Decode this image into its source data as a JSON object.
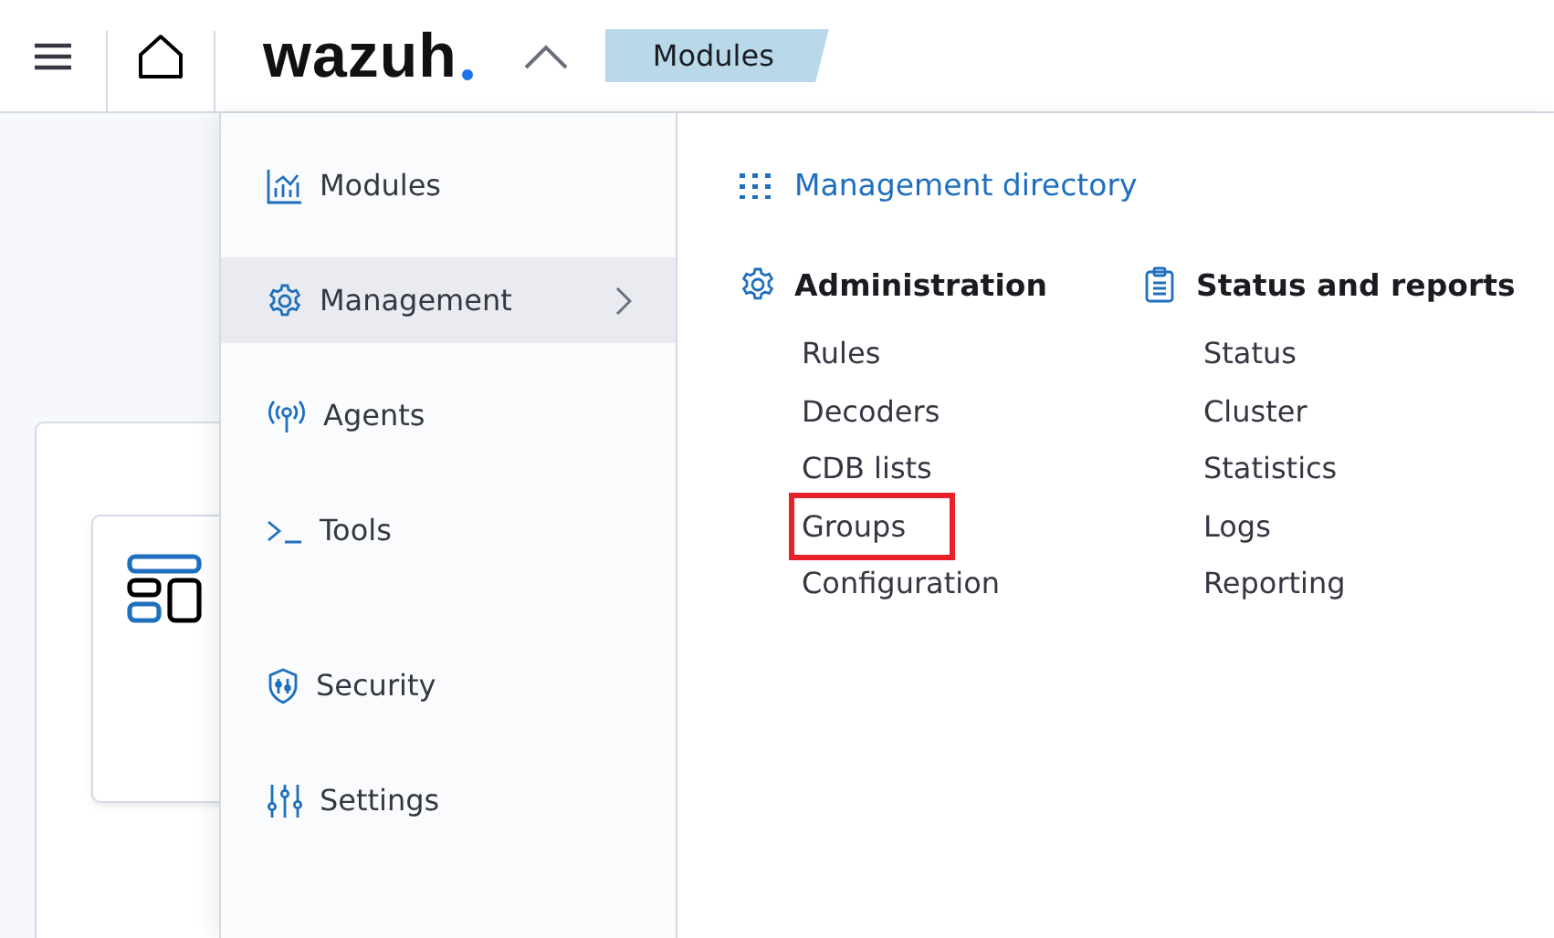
{
  "header": {
    "logo": "wazuh",
    "breadcrumb": "Modules"
  },
  "menu": {
    "groups": [
      {
        "items": [
          {
            "label": "Modules",
            "selected": false,
            "submenu": false
          },
          {
            "label": "Management",
            "selected": true,
            "submenu": true
          },
          {
            "label": "Agents",
            "selected": false,
            "submenu": false
          },
          {
            "label": "Tools",
            "selected": false,
            "submenu": false
          }
        ]
      },
      {
        "items": [
          {
            "label": "Security",
            "selected": false,
            "submenu": false
          },
          {
            "label": "Settings",
            "selected": false,
            "submenu": false
          }
        ]
      }
    ]
  },
  "submenu": {
    "directory_link": "Management directory",
    "sections": [
      {
        "title": "Administration",
        "items": [
          {
            "label": "Rules",
            "highlighted": false
          },
          {
            "label": "Decoders",
            "highlighted": false
          },
          {
            "label": "CDB lists",
            "highlighted": false
          },
          {
            "label": "Groups",
            "highlighted": true
          },
          {
            "label": "Configuration",
            "highlighted": false
          }
        ]
      },
      {
        "title": "Status and reports",
        "items": [
          {
            "label": "Status",
            "highlighted": false
          },
          {
            "label": "Cluster",
            "highlighted": false
          },
          {
            "label": "Statistics",
            "highlighted": false
          },
          {
            "label": "Logs",
            "highlighted": false
          },
          {
            "label": "Reporting",
            "highlighted": false
          }
        ]
      }
    ]
  }
}
